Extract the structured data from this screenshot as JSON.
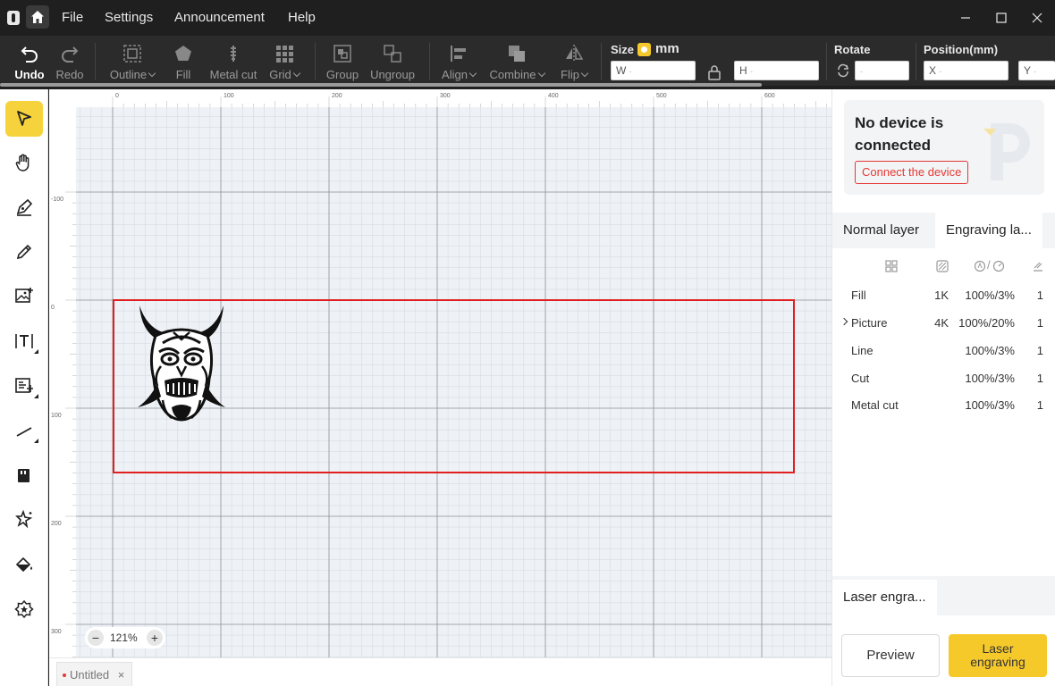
{
  "titlebar": {
    "menus": [
      "File",
      "Settings",
      "Announcement",
      "Help"
    ]
  },
  "toolbar": {
    "undo": "Undo",
    "redo": "Redo",
    "outline": "Outline",
    "fill": "Fill",
    "metal_cut": "Metal cut",
    "grid": "Grid",
    "group": "Group",
    "ungroup": "Ungroup",
    "align": "Align",
    "combine": "Combine",
    "flip": "Flip",
    "size_label": "Size",
    "unit": "mm",
    "w_label": "W",
    "h_label": "H",
    "rotate_label": "Rotate",
    "position_label": "Position(mm)",
    "x_label": "X",
    "y_label": "Y",
    "empty_value": "-"
  },
  "ruler": {
    "top": [
      "0",
      "100",
      "200",
      "300",
      "400",
      "500",
      "600"
    ],
    "left": [
      "-100",
      "0",
      "100",
      "200",
      "300"
    ]
  },
  "canvas": {
    "zoom": "121%",
    "file_tab": "Untitled"
  },
  "device": {
    "title": "No device is connected",
    "connect_label": "Connect the device"
  },
  "layers": {
    "tabs": [
      "Normal layer",
      "Engraving la..."
    ],
    "rate_header": "/",
    "rows": [
      {
        "name": "Fill",
        "res": "1K",
        "power_speed": "100%/3%",
        "passes": "1"
      },
      {
        "name": "Picture",
        "res": "4K",
        "power_speed": "100%/20%",
        "passes": "1"
      },
      {
        "name": "Line",
        "res": "",
        "power_speed": "100%/3%",
        "passes": "1"
      },
      {
        "name": "Cut",
        "res": "",
        "power_speed": "100%/3%",
        "passes": "1"
      },
      {
        "name": "Metal cut",
        "res": "",
        "power_speed": "100%/3%",
        "passes": "1"
      }
    ]
  },
  "bottom": {
    "mode_tab": "Laser engra...",
    "preview": "Preview",
    "engrave_line1": "Laser",
    "engrave_line2": "engraving"
  },
  "colors": {
    "accent": "#f6c92b",
    "selection": "#e02020",
    "danger": "#e53935"
  }
}
